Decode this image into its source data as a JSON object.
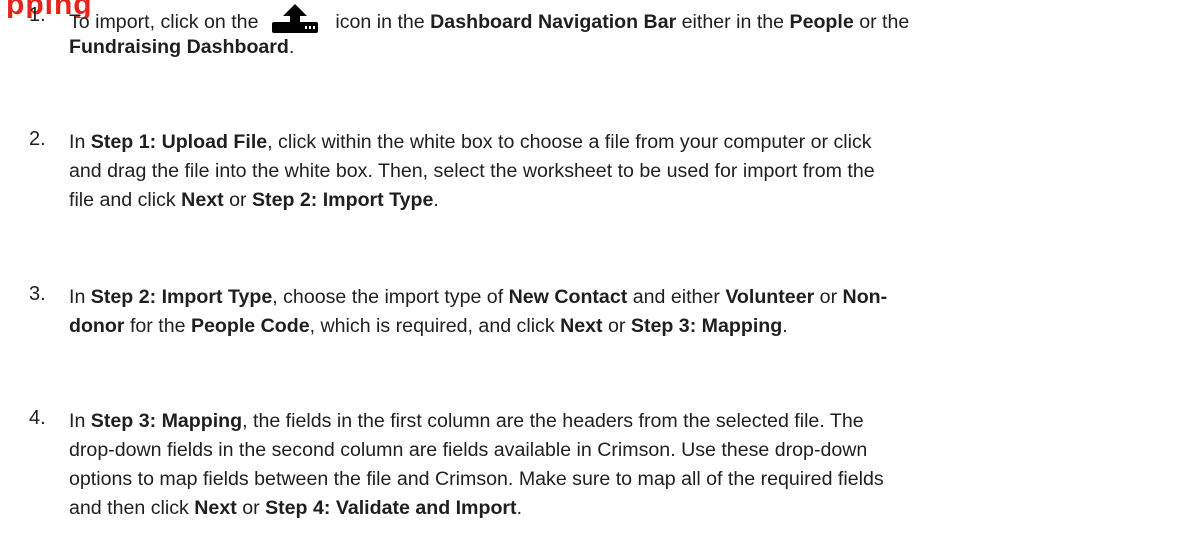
{
  "heading_fragment": "pping",
  "steps": [
    {
      "number": "1.",
      "lines": [
        [
          {
            "t": "To import, click on the ",
            "b": false
          },
          {
            "icon": "upload-icon"
          },
          {
            "t": " icon in the ",
            "b": false
          },
          {
            "t": "Dashboard Navigation Bar",
            "b": true
          },
          {
            "t": " either in the ",
            "b": false
          },
          {
            "t": "People",
            "b": true
          },
          {
            "t": " or the",
            "b": false
          }
        ],
        [
          {
            "t": "Fundraising Dashboard",
            "b": true
          },
          {
            "t": ".",
            "b": false
          }
        ]
      ]
    },
    {
      "number": "2.",
      "lines": [
        [
          {
            "t": "In ",
            "b": false
          },
          {
            "t": "Step 1: Upload File",
            "b": true
          },
          {
            "t": ", click within the white box to choose a file from your computer or click",
            "b": false
          }
        ],
        [
          {
            "t": "and drag the file into the white box. Then, select the worksheet to be used for import from the",
            "b": false
          }
        ],
        [
          {
            "t": "file and click ",
            "b": false
          },
          {
            "t": "Next",
            "b": true
          },
          {
            "t": " or ",
            "b": false
          },
          {
            "t": "Step 2: Import Type",
            "b": true
          },
          {
            "t": ".",
            "b": false
          }
        ]
      ]
    },
    {
      "number": "3.",
      "lines": [
        [
          {
            "t": "In ",
            "b": false
          },
          {
            "t": "Step 2: Import Type",
            "b": true
          },
          {
            "t": ", choose the import type of ",
            "b": false
          },
          {
            "t": "New Contact",
            "b": true
          },
          {
            "t": " and either ",
            "b": false
          },
          {
            "t": "Volunteer",
            "b": true
          },
          {
            "t": " or ",
            "b": false
          },
          {
            "t": "Non-",
            "b": true
          }
        ],
        [
          {
            "t": "donor",
            "b": true
          },
          {
            "t": " for the ",
            "b": false
          },
          {
            "t": "People Code",
            "b": true
          },
          {
            "t": ", which is required, and click ",
            "b": false
          },
          {
            "t": "Next",
            "b": true
          },
          {
            "t": " or ",
            "b": false
          },
          {
            "t": "Step 3: Mapping",
            "b": true
          },
          {
            "t": ".",
            "b": false
          }
        ]
      ]
    },
    {
      "number": "4.",
      "lines": [
        [
          {
            "t": "In ",
            "b": false
          },
          {
            "t": "Step 3: Mapping",
            "b": true
          },
          {
            "t": ", the fields in the first column are the headers from the selected file. The",
            "b": false
          }
        ],
        [
          {
            "t": "drop-down fields in the second column are fields available in Crimson. Use these drop-down",
            "b": false
          }
        ],
        [
          {
            "t": "options to map fields between the file and Crimson. Make sure to map all of the required fields",
            "b": false
          }
        ],
        [
          {
            "t": "and then click ",
            "b": false
          },
          {
            "t": "Next",
            "b": true
          },
          {
            "t": " or ",
            "b": false
          },
          {
            "t": "Step 4: Validate and Import",
            "b": true
          },
          {
            "t": ".",
            "b": false
          }
        ]
      ]
    }
  ]
}
